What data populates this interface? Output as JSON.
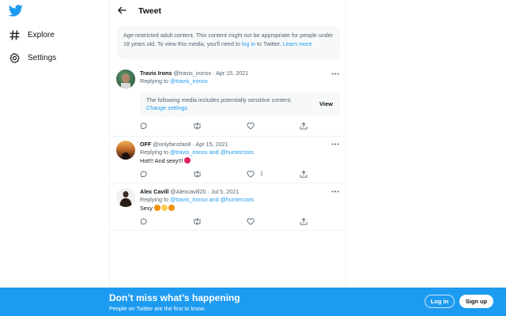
{
  "app": {
    "logo_icon": "twitter-bird-icon",
    "brand_color": "#1d9bf0"
  },
  "nav": {
    "items": [
      {
        "label": "Explore",
        "icon": "hashtag-icon"
      },
      {
        "label": "Settings",
        "icon": "gear-icon"
      }
    ]
  },
  "header": {
    "title": "Tweet",
    "back_icon": "arrow-left-icon"
  },
  "notice": {
    "text_1": "Age-restricted adult content. This content might not be appropriate for people under 18 years old. To view this media, you'll need to ",
    "login_link": "log in",
    "text_2": " to Twitter. ",
    "learn_more": "Learn more"
  },
  "tweets": [
    {
      "name": "Travis Irons",
      "handle": "@travis_ironsx",
      "date": "· Apr 15, 2021",
      "replying_label": "Replying to ",
      "replying_to": "@travis_ironsx",
      "text": "",
      "media_warning": {
        "text": "The following media includes potentially sensitive content.",
        "change_link": "Change settings",
        "view_label": "View"
      },
      "likes": ""
    },
    {
      "name": "OFF",
      "handle": "@onlyfansfan8",
      "date": "· Apr 15, 2021",
      "replying_label": "Replying to ",
      "replying_to": "@travis_ironsx and @huntercoxs",
      "text": "Hot!!! And sexy!!!",
      "emojis": [
        "face-icon"
      ],
      "likes": "1"
    },
    {
      "name": "Alex Cavill",
      "handle": "@Alexcavill20",
      "date": "· Jul 5, 2021",
      "replying_label": "Replying to ",
      "replying_to": "@travis_ironsx and @huntercoxs",
      "text": "Sexy",
      "emojis": [
        "fire-icon",
        "heart-eyes-icon",
        "fire-icon"
      ],
      "likes": ""
    }
  ],
  "banner": {
    "title": "Don’t miss what’s happening",
    "subtitle": "People on Twitter are the first to know.",
    "login_label": "Log in",
    "signup_label": "Sign up"
  }
}
